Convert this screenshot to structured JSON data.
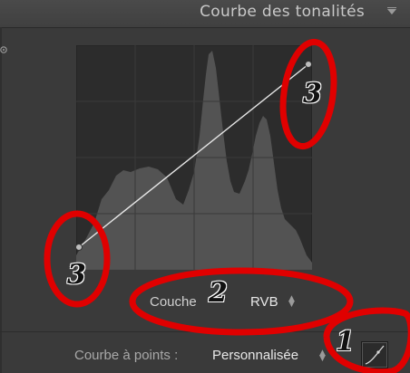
{
  "panel": {
    "title": "Courbe des tonalités"
  },
  "channel": {
    "label": "Couche",
    "value": "RVB"
  },
  "point_curve": {
    "label": "Courbe à points :",
    "value": "Personnalisée"
  },
  "annotations": {
    "n1": "1",
    "n2": "2",
    "n3_top": "3",
    "n3_bottom": "3",
    "color": "#e00000"
  },
  "colors": {
    "panel_bg": "#3a3a3a",
    "graph_bg": "#2c2c2c",
    "histogram": "#5a5a5a",
    "curve": "#e6e6e6"
  }
}
